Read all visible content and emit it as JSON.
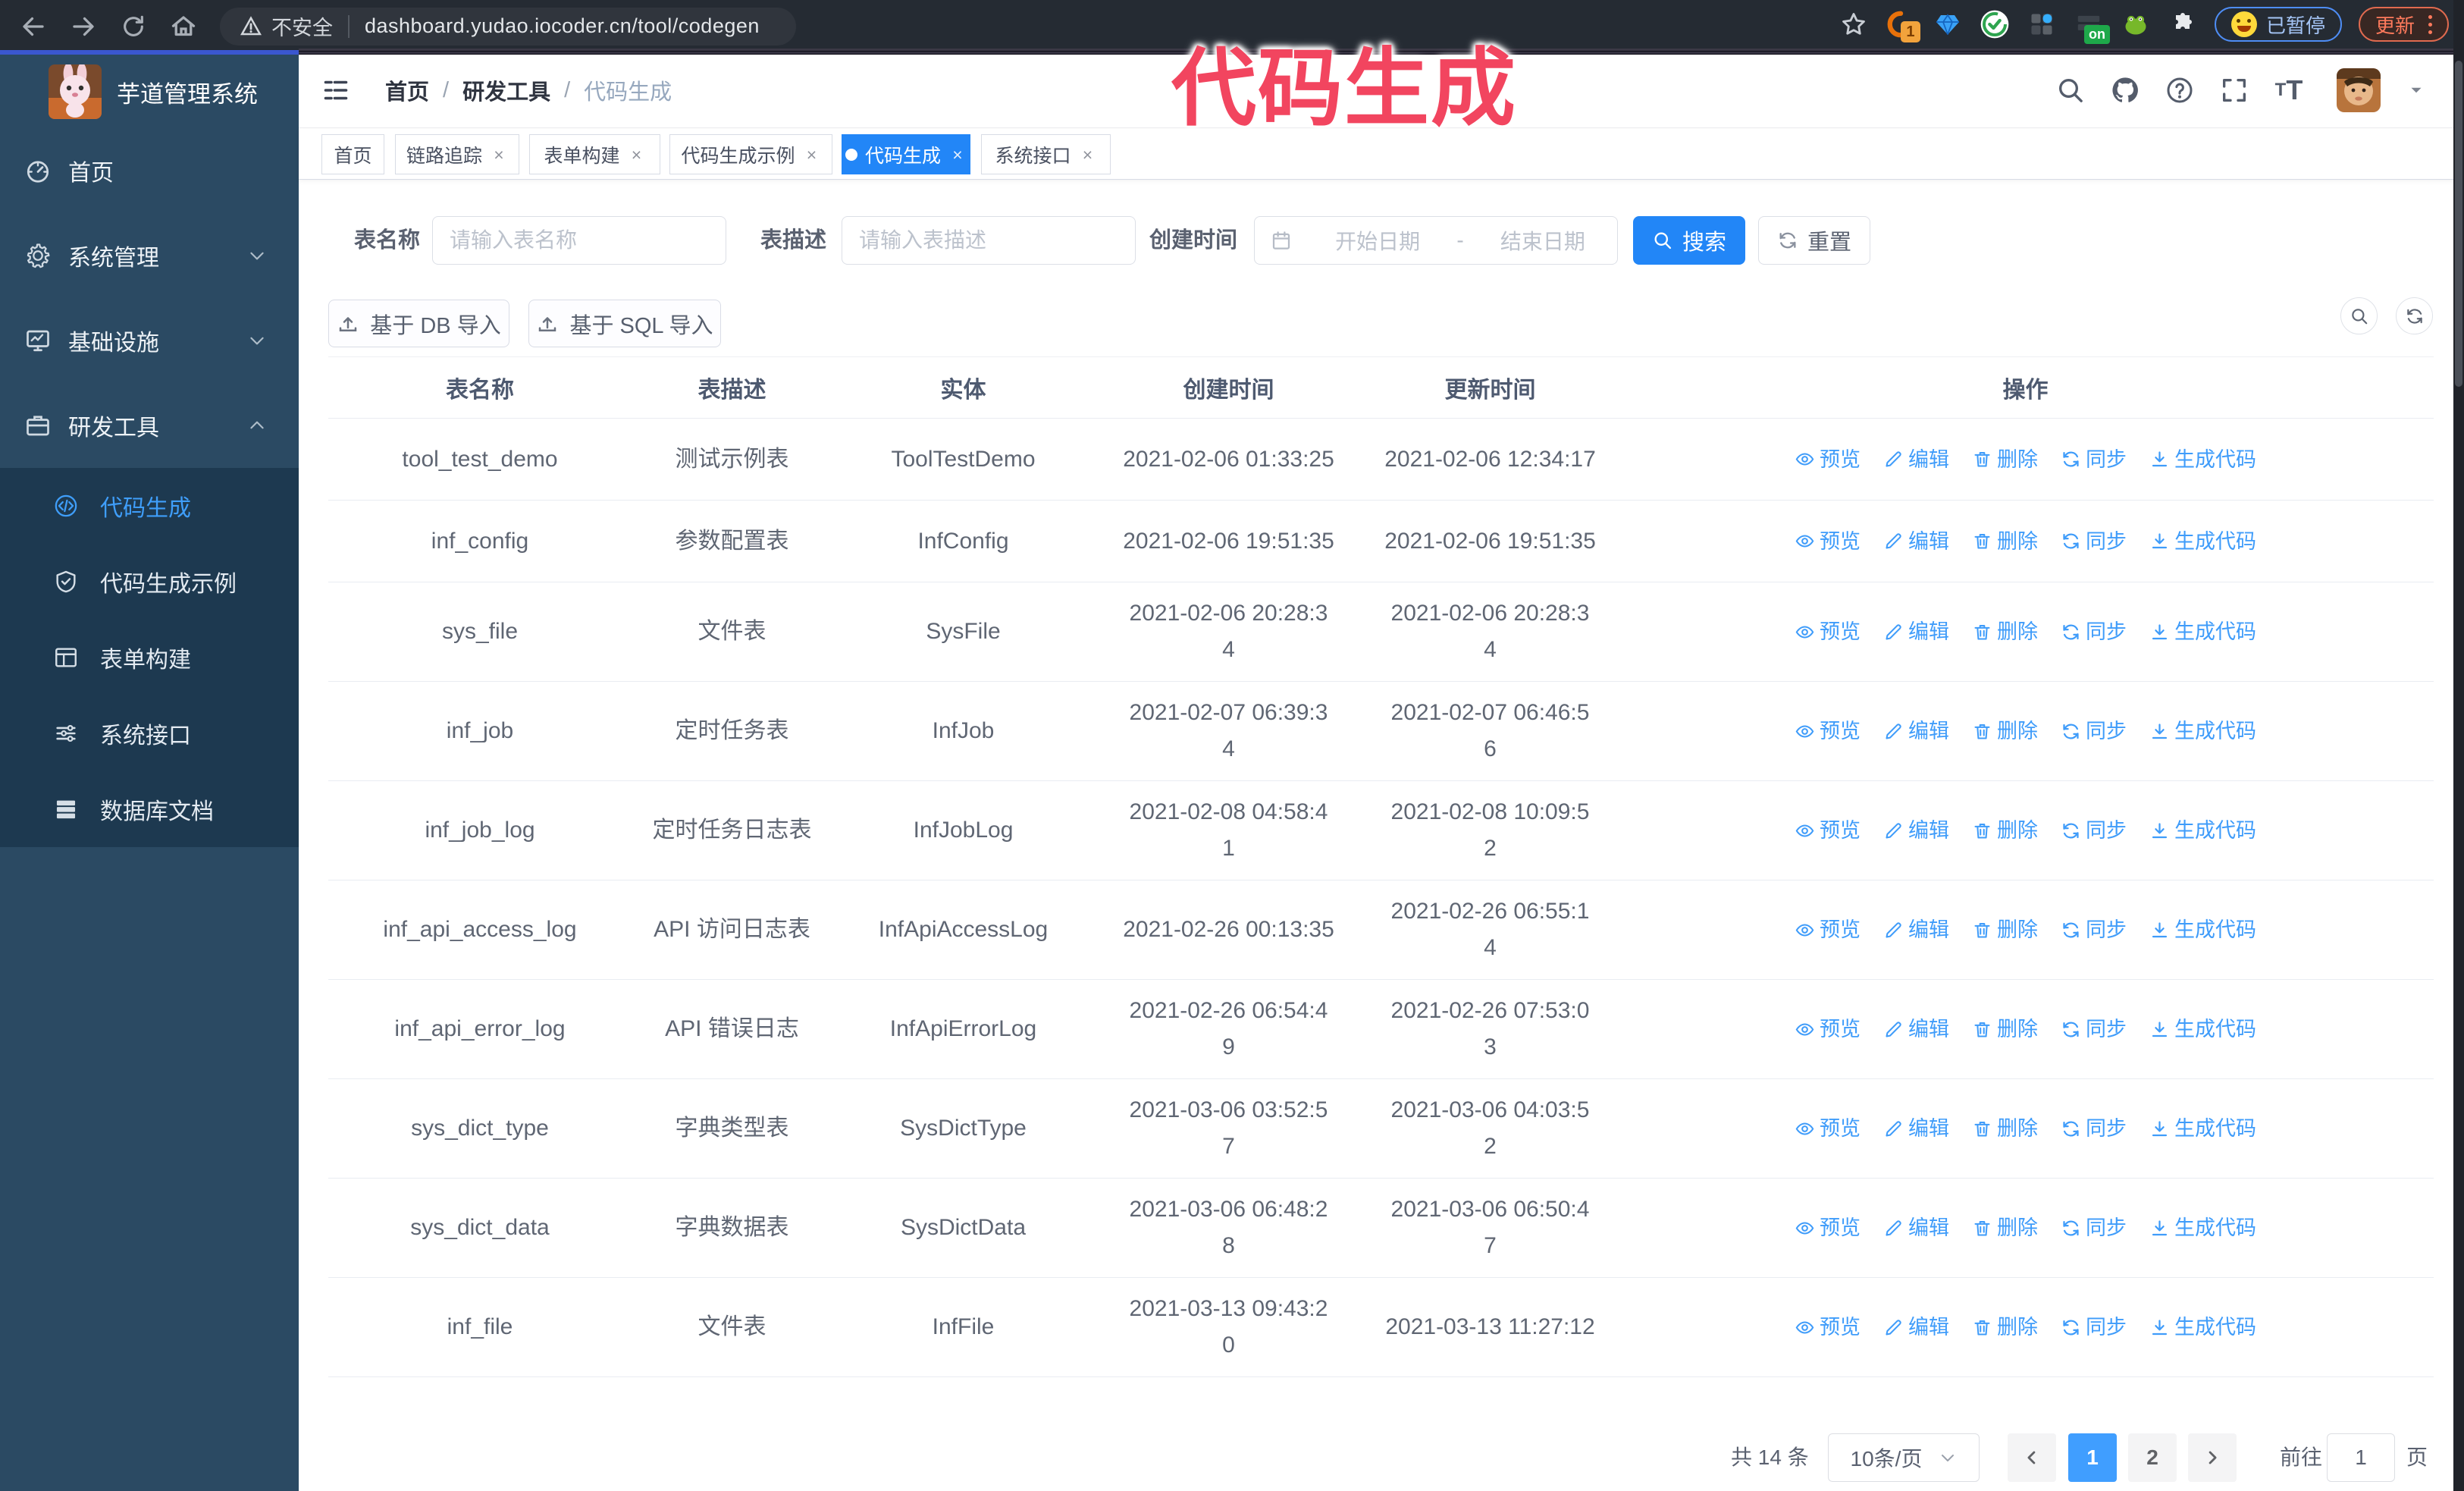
{
  "browser": {
    "security_label": "不安全",
    "url": "dashboard.yudao.iocoder.cn/tool/codegen",
    "extension_badge": "1",
    "on_badge": "on",
    "paused_label": "已暂停",
    "update_label": "更新"
  },
  "annotation": {
    "text": "代码生成",
    "color": "#f2455f"
  },
  "sidebar": {
    "logo_title": "芋道管理系统",
    "items": [
      {
        "label": "首页"
      },
      {
        "label": "系统管理"
      },
      {
        "label": "基础设施"
      },
      {
        "label": "研发工具"
      }
    ],
    "sub_items": [
      {
        "label": "代码生成"
      },
      {
        "label": "代码生成示例"
      },
      {
        "label": "表单构建"
      },
      {
        "label": "系统接口"
      },
      {
        "label": "数据库文档"
      }
    ]
  },
  "breadcrumb": {
    "0": "首页",
    "1": "研发工具",
    "2": "代码生成",
    "separator": "/"
  },
  "tabs": [
    {
      "label": "首页"
    },
    {
      "label": "链路追踪"
    },
    {
      "label": "表单构建"
    },
    {
      "label": "代码生成示例"
    },
    {
      "label": "代码生成"
    },
    {
      "label": "系统接口"
    }
  ],
  "filters": {
    "name_label": "表名称",
    "name_placeholder": "请输入表名称",
    "desc_label": "表描述",
    "desc_placeholder": "请输入表描述",
    "time_label": "创建时间",
    "start_placeholder": "开始日期",
    "range_separator": "-",
    "end_placeholder": "结束日期",
    "search_label": "搜索",
    "reset_label": "重置"
  },
  "toolbar": {
    "import_db_label": "基于 DB 导入",
    "import_sql_label": "基于 SQL 导入"
  },
  "table": {
    "headers": [
      "表名称",
      "表描述",
      "实体",
      "创建时间",
      "更新时间",
      "操作"
    ],
    "actions": [
      "预览",
      "编辑",
      "删除",
      "同步",
      "生成代码"
    ],
    "rows": [
      {
        "name": "tool_test_demo",
        "description": "测试示例表",
        "entity": "ToolTestDemo",
        "create_time": "2021-02-06 01:33:25",
        "update_time": "2021-02-06 12:34:17"
      },
      {
        "name": "inf_config",
        "description": "参数配置表",
        "entity": "InfConfig",
        "create_time": "2021-02-06 19:51:35",
        "update_time": "2021-02-06 19:51:35"
      },
      {
        "name": "sys_file",
        "description": "文件表",
        "entity": "SysFile",
        "create_time": [
          "2021-02-06 20:28:3",
          "4"
        ],
        "update_time": [
          "2021-02-06 20:28:3",
          "4"
        ]
      },
      {
        "name": "inf_job",
        "description": "定时任务表",
        "entity": "InfJob",
        "create_time": [
          "2021-02-07 06:39:3",
          "4"
        ],
        "update_time": [
          "2021-02-07 06:46:5",
          "6"
        ]
      },
      {
        "name": "inf_job_log",
        "description": "定时任务日志表",
        "entity": "InfJobLog",
        "create_time": [
          "2021-02-08 04:58:4",
          "1"
        ],
        "update_time": [
          "2021-02-08 10:09:5",
          "2"
        ]
      },
      {
        "name": "inf_api_access_log",
        "description": "API 访问日志表",
        "entity": "InfApiAccessLog",
        "create_time": "2021-02-26 00:13:35",
        "update_time": [
          "2021-02-26 06:55:1",
          "4"
        ]
      },
      {
        "name": "inf_api_error_log",
        "description": "API 错误日志",
        "entity": "InfApiErrorLog",
        "create_time": [
          "2021-02-26 06:54:4",
          "9"
        ],
        "update_time": [
          "2021-02-26 07:53:0",
          "3"
        ]
      },
      {
        "name": "sys_dict_type",
        "description": "字典类型表",
        "entity": "SysDictType",
        "create_time": [
          "2021-03-06 03:52:5",
          "7"
        ],
        "update_time": [
          "2021-03-06 04:03:5",
          "2"
        ]
      },
      {
        "name": "sys_dict_data",
        "description": "字典数据表",
        "entity": "SysDictData",
        "create_time": [
          "2021-03-06 06:48:2",
          "8"
        ],
        "update_time": [
          "2021-03-06 06:50:4",
          "7"
        ]
      },
      {
        "name": "inf_file",
        "description": "文件表",
        "entity": "InfFile",
        "create_time": [
          "2021-03-13 09:43:2",
          "0"
        ],
        "update_time": "2021-03-13 11:27:12"
      }
    ]
  },
  "pagination": {
    "total_label": "共 14 条",
    "page_size_label": "10条/页",
    "page_1": "1",
    "page_2": "2",
    "goto_label": "前往",
    "goto_value": "1",
    "page_unit": "页"
  },
  "colors": {
    "accent_blue": "#2286f7",
    "pager_active_blue": "#409eff",
    "link_blue": "#3f9cfa",
    "sidebar_bg": "#2b4a63",
    "submenu_bg": "#1d3950",
    "annotation_pink": "#f2455f",
    "chrome_bg": "#252b33"
  }
}
